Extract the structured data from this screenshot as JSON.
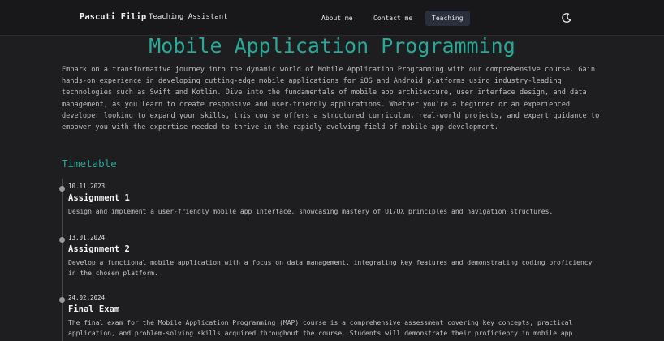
{
  "navbar": {
    "brand_name": "Pascuti Filip",
    "brand_subtitle": "Teaching Assistant",
    "links": [
      "About me",
      "Contact me",
      "Teaching"
    ],
    "active_link": "Teaching",
    "theme_icon": "moon-icon"
  },
  "page": {
    "title": "Mobile Application Programming",
    "intro": "Embark on a transformative journey into the dynamic world of Mobile Application Programming with our comprehensive course. Gain hands-on experience in developing cutting-edge mobile applications for iOS and Android platforms using industry-leading technologies such as Swift and Kotlin. Dive into the fundamentals of mobile app architecture, user interface design, and data management, as you learn to create responsive and user-friendly applications. Whether you're a beginner or an experienced developer looking to expand your skills, this course offers a structured curriculum, real-world projects, and expert guidance to empower you with the expertise needed to thrive in the rapidly evolving field of mobile app development."
  },
  "timetable": {
    "heading": "Timetable",
    "items": [
      {
        "date": "10.11.2023",
        "title": "Assignment 1",
        "description": "Design and implement a user-friendly mobile app interface, showcasing mastery of UI/UX principles and navigation structures."
      },
      {
        "date": "13.01.2024",
        "title": "Assignment 2",
        "description": "Develop a functional mobile application with a focus on data management, integrating key features and demonstrating coding proficiency in the chosen platform."
      },
      {
        "date": "24.02.2024",
        "title": "Final Exam",
        "description": "The final exam for the Mobile Application Programming (MAP) course is a comprehensive assessment covering key concepts, practical application, and problem-solving skills acquired throughout the course. Students will demonstrate their proficiency in mobile app"
      }
    ]
  },
  "colors": {
    "accent": "#2aa898",
    "background": "#1e1e20",
    "navbar": "#18181a",
    "active_tab": "#2a2f3d"
  }
}
